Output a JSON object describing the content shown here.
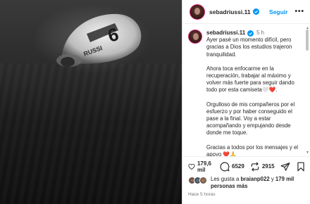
{
  "post": {
    "username": "sebadriussi.11",
    "follow_label": "Seguir",
    "more_label": "•••",
    "caption_time": "5 h",
    "caption_paragraphs": [
      "Ayer pasé un momento difícil, pero gracias a Dios los estudios trajeron tranquilidad.",
      "Ahora toca enfocarme en la recuperación, trabajar al máximo y volver más fuerte para seguir dando todo por esta camiseta🤍❤️.",
      "Orgulloso de mis compañeros por el esfuerzo y por haber conseguido el pase a la final. Voy a estar acompañando y empujando desde donde me toque.",
      "Gracias a todos por los mensajes y el apoyo ❤️🙏"
    ],
    "likes_count": "179,6 mil",
    "comments_count": "6529",
    "reposts_count": "2915",
    "liked_by_prefix": "Les gusta a ",
    "liked_by_user": "braianp022",
    "liked_by_middle": " y ",
    "liked_by_others": "179 mil personas más",
    "time_ago": "Hace 5 horas"
  },
  "colors": {
    "follow_blue": "#0095f6",
    "story_ring": "#d62976",
    "verified_blue": "#0095f6"
  },
  "icons": [
    "verified-badge-icon",
    "more-options-icon",
    "heart-icon",
    "comment-icon",
    "repost-icon",
    "share-icon",
    "bookmark-icon"
  ]
}
